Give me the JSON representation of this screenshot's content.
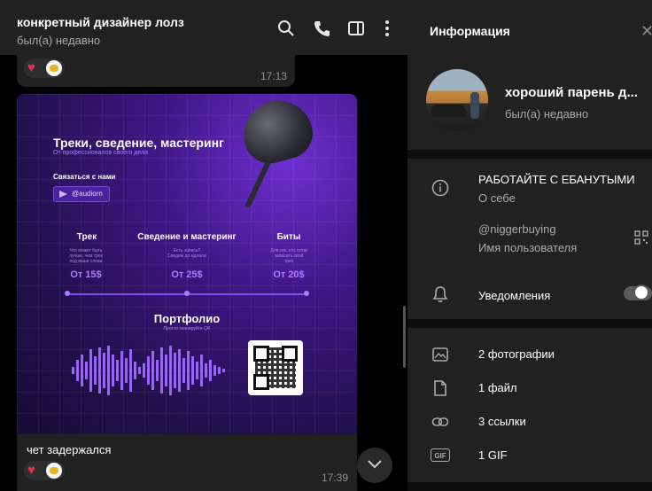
{
  "chat": {
    "title": "конкретный дизайнер лолз",
    "status": "был(а) недавно",
    "messages": [
      {
        "time": "17:13",
        "reactions": [
          "heart",
          "avatar"
        ]
      },
      {
        "caption": "чет задержался",
        "time": "17:39",
        "reactions": [
          "heart",
          "avatar"
        ]
      }
    ],
    "post": {
      "title": "Треки, сведение, мастеринг",
      "subtitle": "От профессионалов своего дела",
      "contact_label": "Связаться с нами",
      "telegram": "@audiorn",
      "services": [
        {
          "name": "Трек",
          "desc": "Что может быть лучше, чем трек под ваши слова",
          "price": "От 15$"
        },
        {
          "name": "Сведение и мастеринг",
          "desc": "Есть запись? Сведем до идеала",
          "price": "От 25$"
        },
        {
          "name": "Биты",
          "desc": "Для тех, кто готов записать свой трек",
          "price": "От 20$"
        }
      ],
      "portfolio_title": "Портфолио",
      "portfolio_sub": "Просто сканируйте QR"
    }
  },
  "info": {
    "title": "Информация",
    "name": "хороший парень д...",
    "status": "был(а) недавно",
    "bio": "РАБОТАЙТЕ С ЕБАНУТЫМИ",
    "bio_label": "О себе",
    "username": "@niggerbuying",
    "username_label": "Имя пользователя",
    "notifications_label": "Уведомления",
    "notifications_on": true,
    "media": [
      {
        "icon": "photo-icon",
        "label": "2 фотографии"
      },
      {
        "icon": "file-icon",
        "label": "1 файл"
      },
      {
        "icon": "link-icon",
        "label": "3 ссылки"
      },
      {
        "icon": "gif-icon",
        "label": "1 GIF",
        "badge": "GIF"
      }
    ]
  },
  "colors": {
    "accent": "#7e4ef0",
    "heart": "#e2334a",
    "panel": "#212121"
  }
}
